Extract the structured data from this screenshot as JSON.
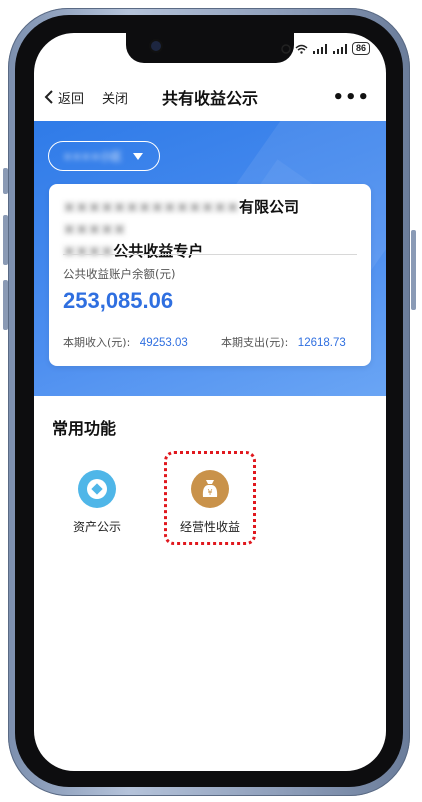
{
  "status": {
    "battery": "86"
  },
  "nav": {
    "back_label": "返回",
    "close_label": "关闭",
    "title": "共有收益公示",
    "more_label": "•••"
  },
  "selector": {
    "value": "××××小区"
  },
  "card": {
    "name_prefix": "××××××××××××××",
    "name_visible": "有限公司",
    "name_suffix": "×××××",
    "name_line2_blur": "××××",
    "name_line2_visible": "公共收益专户",
    "balance_label": "公共收益账户余额(元)",
    "balance_value": "253,085.06",
    "income_label": "本期收入(元):",
    "income_value": "49253.03",
    "expense_label": "本期支出(元):",
    "expense_value": "12618.73"
  },
  "functions": {
    "title": "常用功能",
    "items": [
      {
        "label": "资产公示",
        "icon": "asset-icon",
        "color": "#4fb6e8"
      },
      {
        "label": "经营性收益",
        "icon": "money-bag-icon",
        "color": "#c9924a"
      }
    ]
  },
  "colors": {
    "accent": "#2f6fe0",
    "hero": "#3b82ee",
    "highlight": "#e0181e"
  }
}
